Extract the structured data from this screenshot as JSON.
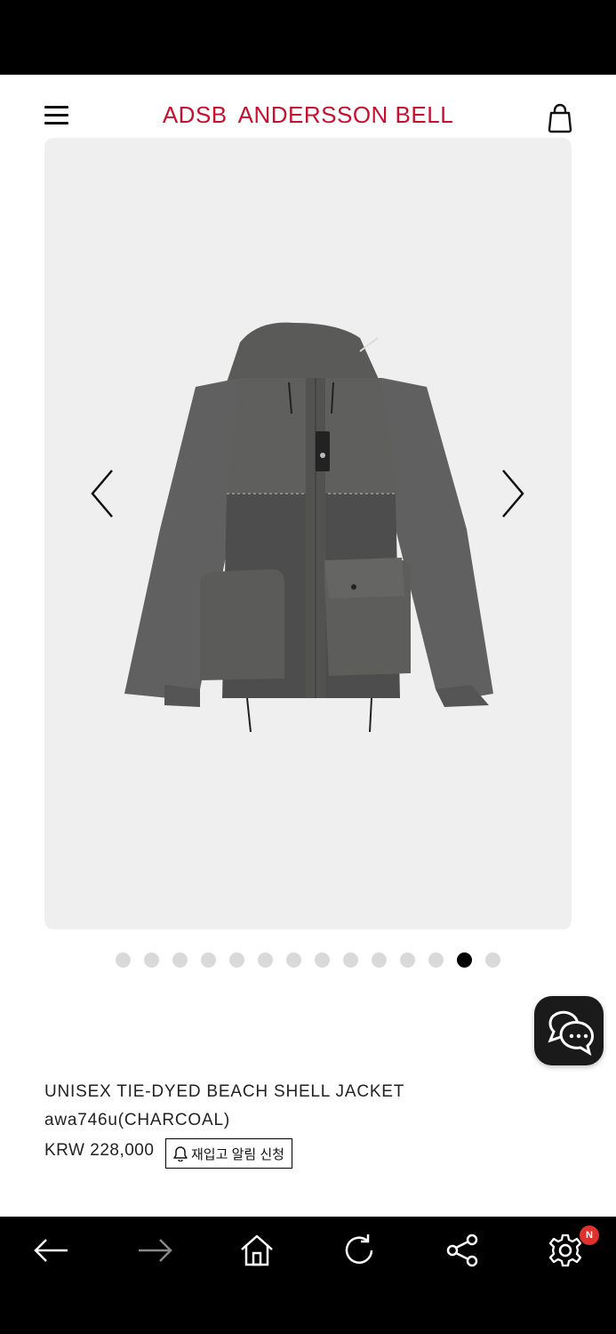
{
  "header": {
    "brand_mark": "ADSB",
    "brand_name": "ANDERSSON BELL"
  },
  "gallery": {
    "image_alt": "UNISEX TIE-DYED BEACH SHELL JACKET",
    "dot_count": 14,
    "active_index": 12
  },
  "product": {
    "name": "UNISEX TIE-DYED BEACH SHELL JACKET",
    "code": "awa746u(CHARCOAL)",
    "price": "KRW 228,000",
    "restock_label": "재입고 알림 신청"
  },
  "bottom_nav": {
    "badge": "N"
  },
  "colors": {
    "brand": "#c8102e",
    "badge": "#e0322d",
    "gallery_bg": "#efefef"
  },
  "icons": [
    "menu-icon",
    "shopping-bag-icon",
    "chevron-left-icon",
    "chevron-right-icon",
    "chat-icon",
    "bell-icon",
    "back-arrow-icon",
    "forward-arrow-icon",
    "home-icon",
    "refresh-icon",
    "share-icon",
    "settings-icon"
  ]
}
